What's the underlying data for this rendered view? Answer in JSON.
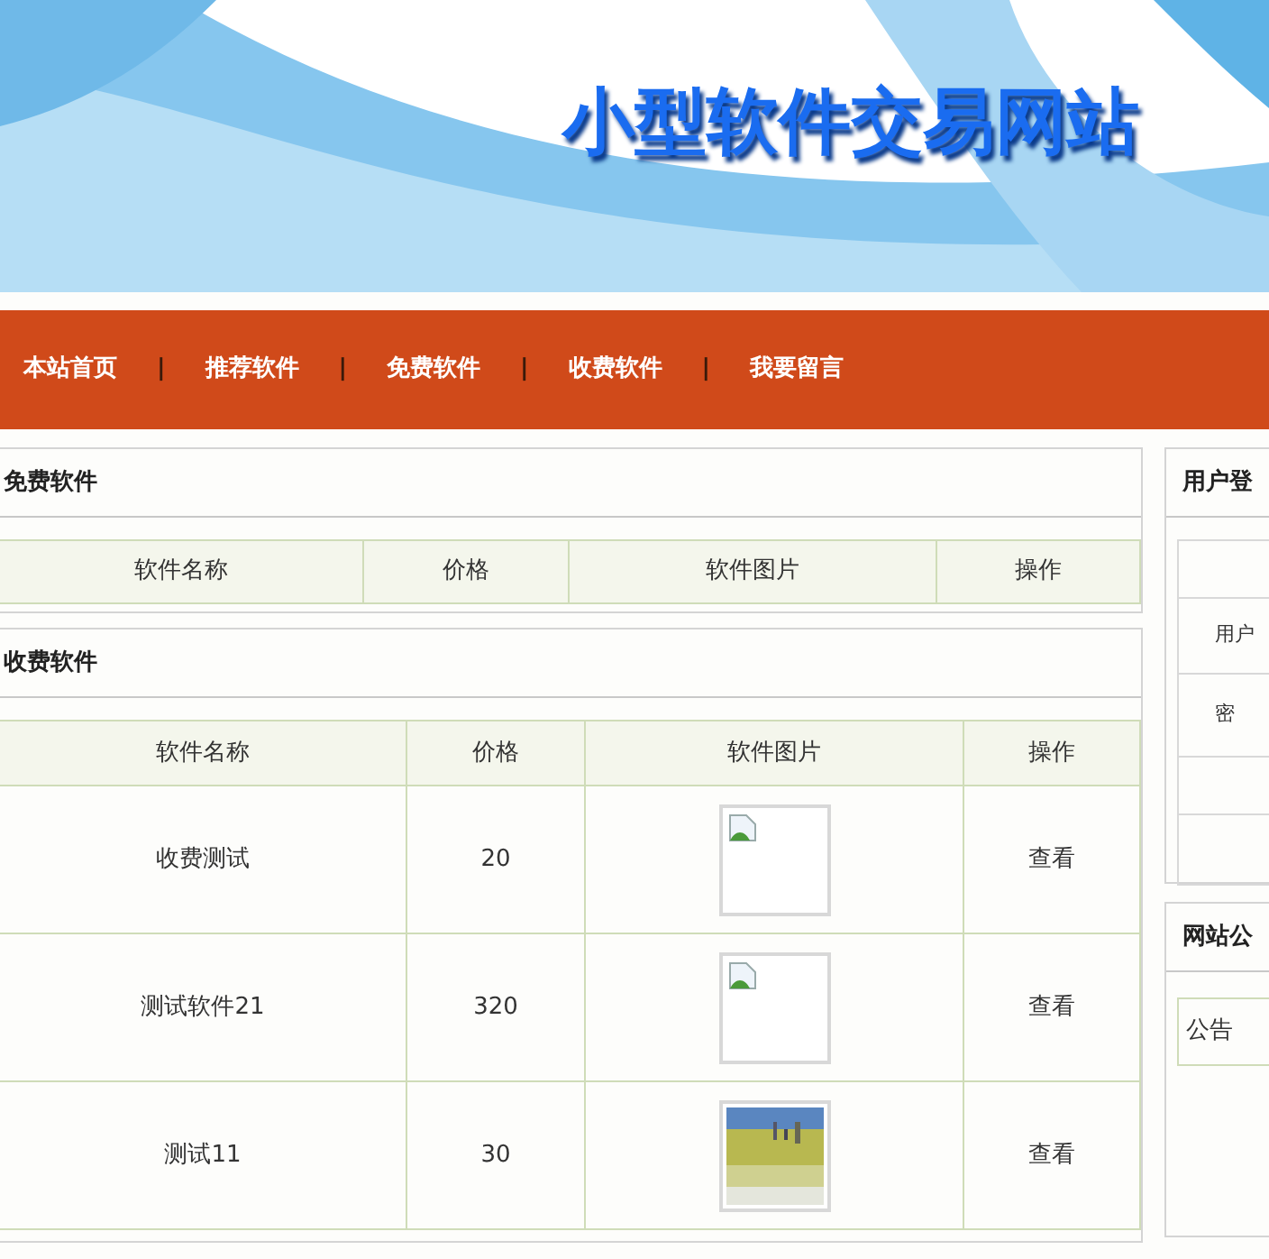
{
  "banner": {
    "title": "小型软件交易网站"
  },
  "nav": [
    {
      "kind": "link",
      "label": "本站首页"
    },
    {
      "kind": "separator",
      "label": "|"
    },
    {
      "kind": "link",
      "label": "推荐软件"
    },
    {
      "kind": "separator",
      "label": "|"
    },
    {
      "kind": "link",
      "label": "免费软件"
    },
    {
      "kind": "separator",
      "label": "|"
    },
    {
      "kind": "link",
      "label": "收费软件"
    },
    {
      "kind": "separator",
      "label": "|"
    },
    {
      "kind": "link",
      "label": "我要留言"
    }
  ],
  "free_panel": {
    "title": "免费软件",
    "columns": [
      "软件名称",
      "价格",
      "软件图片",
      "操作"
    ]
  },
  "paid_panel": {
    "title": "收费软件",
    "columns": [
      "软件名称",
      "价格",
      "软件图片",
      "操作"
    ],
    "rows": [
      {
        "name": "收费测试",
        "price": "20",
        "kind": "broken",
        "action": "查看"
      },
      {
        "name": "测试软件21",
        "price": "320",
        "kind": "broken",
        "action": "查看"
      },
      {
        "name": "测试11",
        "price": "30",
        "kind": "picture",
        "action": "查看"
      }
    ]
  },
  "login_panel": {
    "title": "用户登",
    "username_label": "用户",
    "password_label": "密"
  },
  "notice_panel": {
    "title": "网站公",
    "items": [
      "公告"
    ]
  }
}
